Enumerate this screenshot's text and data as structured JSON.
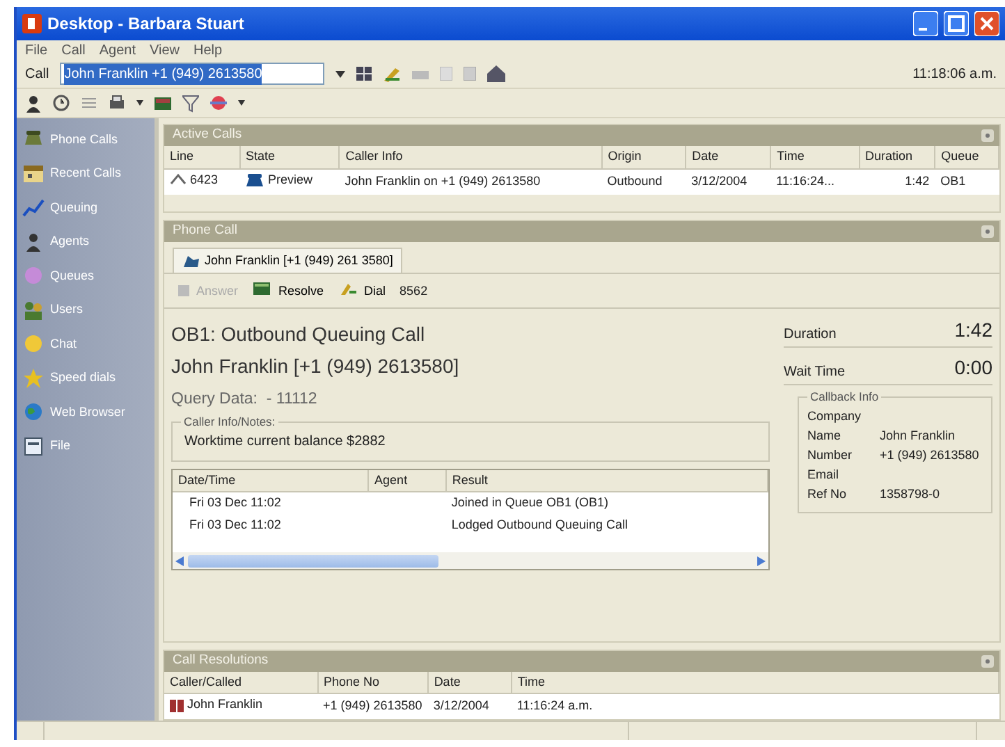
{
  "window": {
    "title": "Desktop - Barbara Stuart"
  },
  "menu": [
    "File",
    "Call",
    "Agent",
    "View",
    "Help"
  ],
  "call_bar": {
    "label": "Call",
    "value": "John Franklin +1 (949) 2613580",
    "highlighted": true,
    "clock": "11:18:06 a.m."
  },
  "sidebar": {
    "items": [
      {
        "label": "Phone Calls"
      },
      {
        "label": "Recent Calls"
      },
      {
        "label": "Queuing"
      },
      {
        "label": "Agents"
      },
      {
        "label": "Queues"
      },
      {
        "label": "Users"
      },
      {
        "label": "Chat"
      },
      {
        "label": "Speed dials"
      },
      {
        "label": "Web Browser"
      },
      {
        "label": "File"
      }
    ]
  },
  "active_calls": {
    "title": "Active Calls",
    "columns": [
      "Line",
      "State",
      "Caller Info",
      "Origin",
      "Date",
      "Time",
      "Duration",
      "Queue"
    ],
    "rows": [
      [
        "6423",
        "Preview",
        "John Franklin on +1 (949) 2613580",
        "Outbound",
        "3/12/2004",
        "11:16:24...",
        "1:42",
        "OB1"
      ]
    ]
  },
  "phone_call": {
    "title": "Phone Call",
    "tabs": [
      {
        "label": "John Franklin [+1 (949) 261 3580]",
        "selected": true
      }
    ],
    "actions": [
      {
        "label": "Answer",
        "disabled": true
      },
      {
        "label": "Resolve",
        "disabled": false
      },
      {
        "label": "Dial",
        "disabled": false
      }
    ],
    "extension": "8562",
    "heading": "OB1: Outbound Queuing Call",
    "caller": "John Franklin [+1 (949) 2613580]",
    "query": "Query Data:  - 11112",
    "notes": {
      "legend": "Caller Info/Notes:",
      "text": "Worktime current balance $2882"
    },
    "history": {
      "columns": [
        "Date/Time",
        "Agent",
        "Result"
      ],
      "rows": [
        [
          "Fri 03 Dec 11:02",
          null,
          "Joined in Queue OB1 (OB1)"
        ],
        [
          "Fri 03 Dec 11:02",
          null,
          "Lodged Outbound Queuing Call"
        ]
      ]
    },
    "timers": [
      {
        "label": "Duration",
        "value": "1:42"
      },
      {
        "label": "Wait Time",
        "value": "0:00"
      }
    ],
    "callback": {
      "legend": "Callback Info",
      "fields": [
        {
          "label": "Company"
        },
        {
          "label": "Name",
          "value": "John Franklin"
        },
        {
          "label": "Number",
          "value": "+1 (949) 2613580"
        },
        {
          "label": "Email"
        },
        {
          "label": "Ref No",
          "value": "1358798-0"
        }
      ]
    }
  },
  "resolutions": {
    "title": "Call Resolutions",
    "columns": [
      "Caller/Called",
      "Phone No",
      "Date",
      "Time"
    ],
    "rows": [
      [
        "John Franklin",
        "+1 (949) 2613580",
        "3/12/2004",
        "11:16:24 a.m."
      ]
    ]
  }
}
